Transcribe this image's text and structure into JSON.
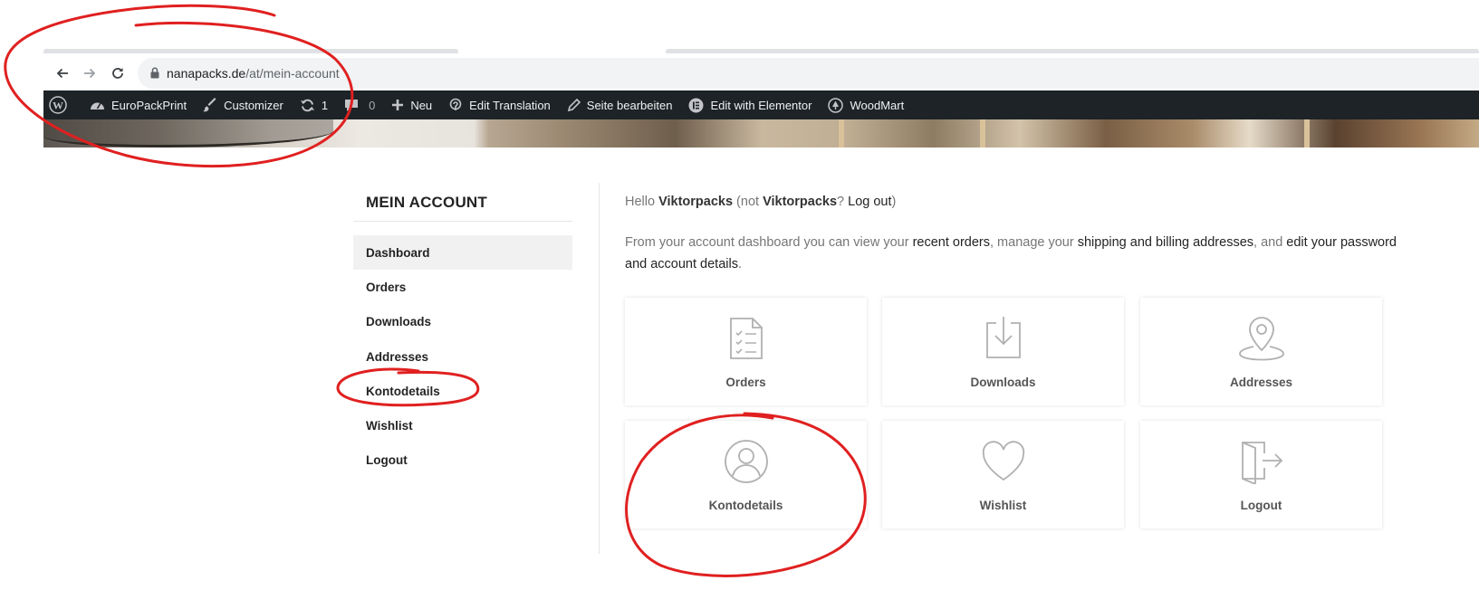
{
  "browser": {
    "url_host": "nanapacks.de",
    "url_path": "/at/mein-account"
  },
  "adminbar": {
    "items": [
      {
        "label": "",
        "icon": "wordpress-icon"
      },
      {
        "label": "EuroPackPrint",
        "icon": "dashboard-icon"
      },
      {
        "label": "Customizer",
        "icon": "brush-icon"
      },
      {
        "label": "1",
        "icon": "updates-icon"
      },
      {
        "label": "0",
        "icon": "comments-icon"
      },
      {
        "label": "Neu",
        "icon": "plus-icon"
      },
      {
        "label": "Edit Translation",
        "icon": "translate-icon"
      },
      {
        "label": "Seite bearbeiten",
        "icon": "pencil-icon"
      },
      {
        "label": "Edit with Elementor",
        "icon": "elementor-icon"
      },
      {
        "label": "WoodMart",
        "icon": "tree-icon"
      }
    ]
  },
  "sidebar": {
    "title": "MEIN ACCOUNT",
    "items": [
      {
        "label": "Dashboard",
        "active": true
      },
      {
        "label": "Orders"
      },
      {
        "label": "Downloads"
      },
      {
        "label": "Addresses"
      },
      {
        "label": "Kontodetails"
      },
      {
        "label": "Wishlist"
      },
      {
        "label": "Logout"
      }
    ]
  },
  "main": {
    "hello_prefix": "Hello ",
    "user": "Viktorpacks",
    "hello_not": " (not ",
    "user2": "Viktorpacks",
    "hello_q": "? ",
    "logout_link": "Log out",
    "hello_end": ")",
    "intro_1": "From your account dashboard you can view your ",
    "link_orders": "recent orders",
    "intro_2": ", manage your ",
    "link_addresses": "shipping and billing addresses",
    "intro_3": ", and ",
    "link_password": "edit your password and account details",
    "intro_4": ".",
    "cards": [
      {
        "label": "Orders",
        "icon": "orders-icon"
      },
      {
        "label": "Downloads",
        "icon": "downloads-icon"
      },
      {
        "label": "Addresses",
        "icon": "location-pin-icon"
      },
      {
        "label": "Kontodetails",
        "icon": "user-icon"
      },
      {
        "label": "Wishlist",
        "icon": "heart-icon"
      },
      {
        "label": "Logout",
        "icon": "logout-icon"
      }
    ]
  },
  "colors": {
    "annotation_red": "#e02020",
    "adminbar_bg": "#1d2327"
  }
}
